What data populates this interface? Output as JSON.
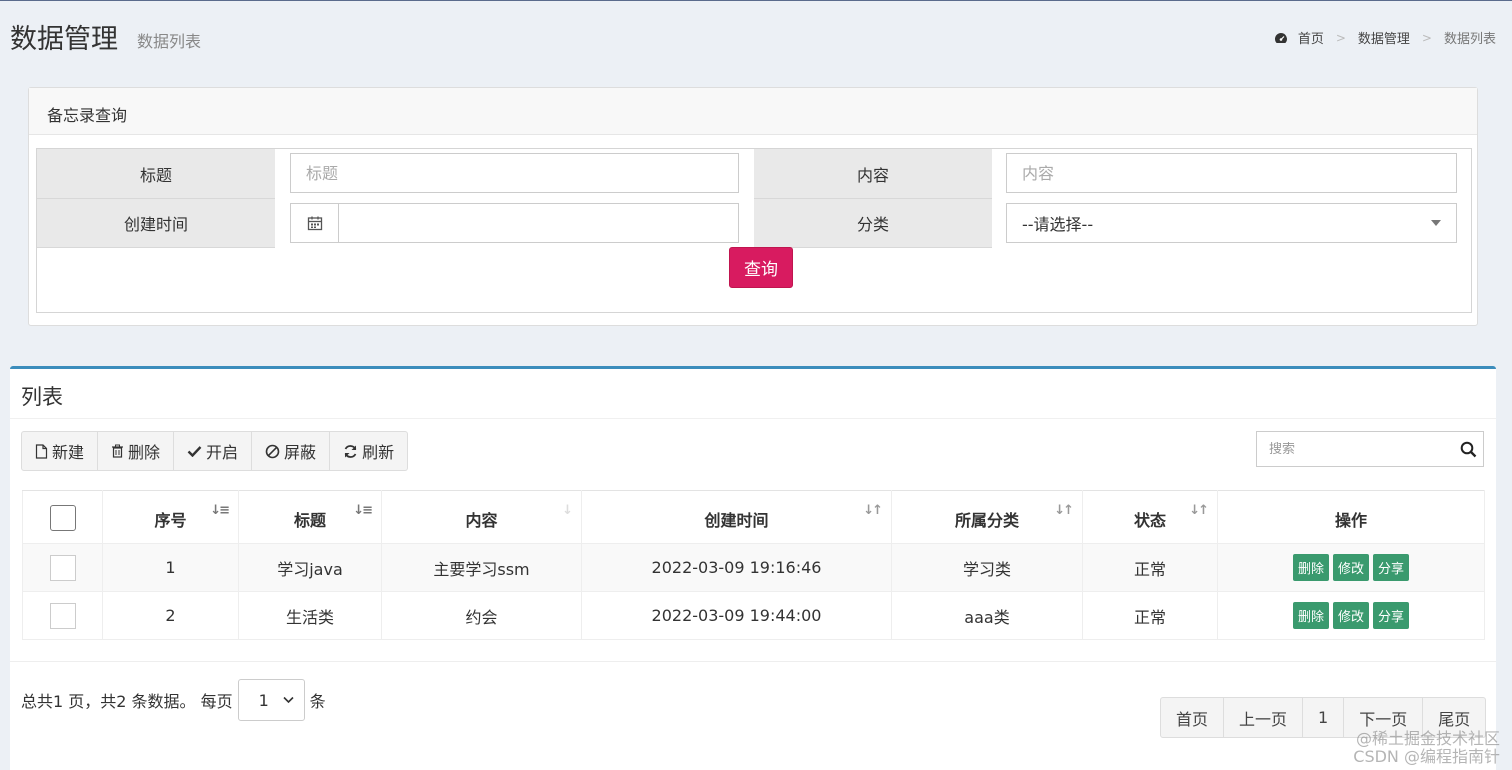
{
  "header": {
    "title": "数据管理",
    "subtitle": "数据列表",
    "breadcrumb": [
      "首页",
      "数据管理",
      "数据列表"
    ],
    "breadcrumb_sep": ">"
  },
  "query": {
    "panel_title": "备忘录查询",
    "title_label": "标题",
    "title_placeholder": "标题",
    "content_label": "内容",
    "content_placeholder": "内容",
    "created_label": "创建时间",
    "category_label": "分类",
    "category_selected": "--请选择--",
    "submit_label": "查询"
  },
  "list": {
    "title": "列表",
    "toolbar": {
      "new": "新建",
      "delete": "删除",
      "enable": "开启",
      "block": "屏蔽",
      "refresh": "刷新"
    },
    "search_placeholder": "搜索",
    "columns": [
      "序号",
      "标题",
      "内容",
      "创建时间",
      "所属分类",
      "状态",
      "操作"
    ],
    "rows": [
      {
        "no": "1",
        "title": "学习java",
        "content": "主要学习ssm",
        "created": "2022-03-09 19:16:46",
        "category": "学习类",
        "status": "正常"
      },
      {
        "no": "2",
        "title": "生活类",
        "content": "约会",
        "created": "2022-03-09 19:44:00",
        "category": "aaa类",
        "status": "正常"
      }
    ],
    "row_actions": {
      "delete": "删除",
      "edit": "修改",
      "share": "分享"
    }
  },
  "pager": {
    "summary": "总共1 页，共2 条数据。 每页",
    "page_size": "1",
    "unit": "条",
    "first": "首页",
    "prev": "上一页",
    "current": "1",
    "next": "下一页",
    "last": "尾页"
  },
  "watermark": {
    "line1": "@稀土掘金技术社区",
    "line2": "CSDN @编程指南针"
  },
  "colors": {
    "primary": "#3c8dbc",
    "query_button": "#d81b60",
    "action_button": "#3a9a6e",
    "background": "#ecf0f5"
  },
  "icons": {
    "breadcrumb_home": "dashboard-icon",
    "date_addon": "calendar-icon",
    "new": "file-icon",
    "delete": "trash-icon",
    "enable": "check-icon",
    "block": "ban-icon",
    "refresh": "refresh-icon",
    "search": "search-icon",
    "sort": "sort-icon"
  }
}
